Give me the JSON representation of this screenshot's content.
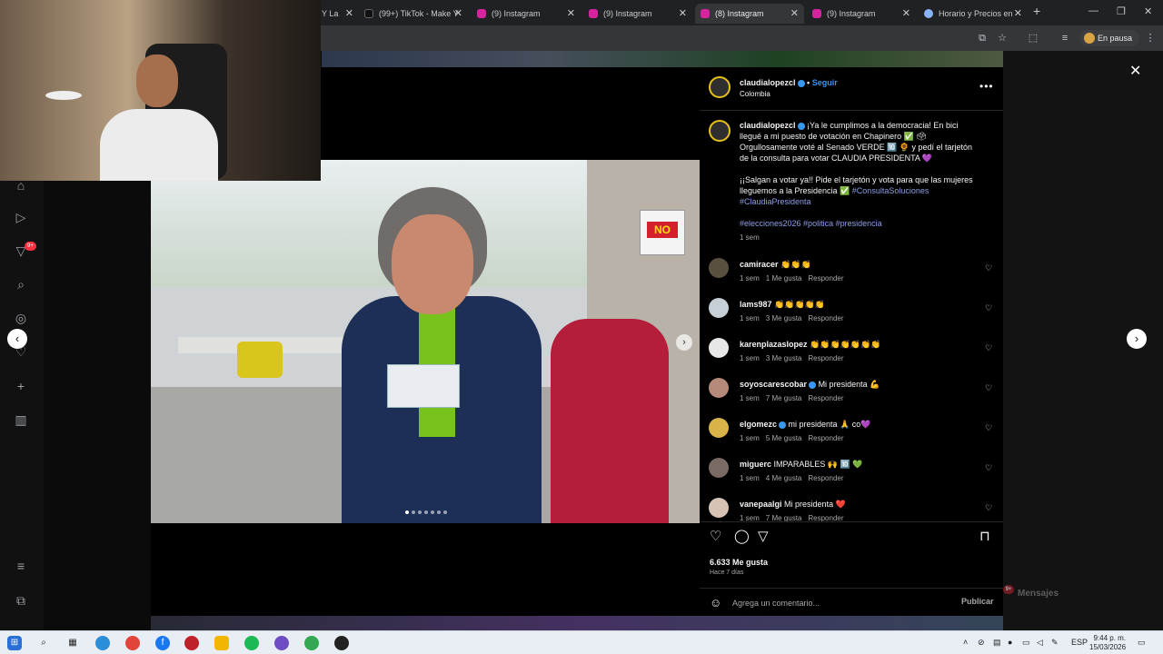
{
  "browser": {
    "tabs": [
      {
        "title": "Y La",
        "color": "#c0392b",
        "active": false
      },
      {
        "title": "(99+) TikTok - Make Y",
        "color": "#111111",
        "active": false
      },
      {
        "title": "(9) Instagram",
        "color": "#d6249f",
        "active": false
      },
      {
        "title": "(9) Instagram",
        "color": "#d6249f",
        "active": false
      },
      {
        "title": "(8) Instagram",
        "color": "#d6249f",
        "active": true
      },
      {
        "title": "(9) Instagram",
        "color": "#d6249f",
        "active": false
      },
      {
        "title": "Horario y Precios en",
        "color": "#8ab4f8",
        "active": false
      }
    ],
    "new_tab": "+",
    "profile_pill": "En pausa"
  },
  "post": {
    "author": "claudialopezcl",
    "follow": "Seguir",
    "location": "Colombia",
    "caption_line1": "¡Ya le cumplimos a la democracia! En bici llegué a mi puesto de votación en Chapinero ✅ 🗳 Orgullosamente voté al Senado VERDE 🔟 🌻 y pedí el tarjetón de la consulta para votar CLAUDIA PRESIDENTA 💜",
    "caption_line2": "¡¡Salgan a votar ya!! Pide el tarjetón y vota para que las mujeres lleguemos a la Presidencia ✅",
    "caption_tags2": "#ConsultaSoluciones #ClaudiaPresidenta",
    "caption_tags3": "#elecciones2026 #politica #presidencia",
    "caption_time": "1 sem",
    "photo_sign": "NO",
    "likes": "6.633 Me gusta",
    "ago": "Hace 7 días",
    "comment_placeholder": "Agrega un comentario...",
    "publish": "Publicar"
  },
  "comments": [
    {
      "user": "camiracer",
      "text": "👏👏👏",
      "time": "1 sem",
      "likes": "1 Me gusta",
      "reply": "Responder",
      "avatar": "#5a5040",
      "verified": false
    },
    {
      "user": "lams987",
      "text": "👏👏👏👏👏",
      "time": "1 sem",
      "likes": "3 Me gusta",
      "reply": "Responder",
      "avatar": "#c6cfd6",
      "verified": false
    },
    {
      "user": "karenplazaslopez",
      "text": "👏👏👏👏👏👏👏",
      "time": "1 sem",
      "likes": "3 Me gusta",
      "reply": "Responder",
      "avatar": "#e7e7e7",
      "verified": false
    },
    {
      "user": "soyoscarescobar",
      "text": "Mi presidenta 💪",
      "time": "1 sem",
      "likes": "7 Me gusta",
      "reply": "Responder",
      "avatar": "#b58a7a",
      "verified": true
    },
    {
      "user": "elgomezc",
      "text": "mi presidenta 🙏 co💜",
      "time": "1 sem",
      "likes": "5 Me gusta",
      "reply": "Responder",
      "avatar": "#d8b34a",
      "verified": true
    },
    {
      "user": "miguerc",
      "text": "IMPARABLES 🙌 🔟 💚",
      "time": "1 sem",
      "likes": "4 Me gusta",
      "reply": "Responder",
      "avatar": "#7a6a64",
      "verified": false
    },
    {
      "user": "vanepaalgi",
      "text": "Mi presidenta ❤️",
      "time": "1 sem",
      "likes": "7 Me gusta",
      "reply": "Responder",
      "avatar": "#d7c2b6",
      "verified": false
    }
  ],
  "messages": {
    "label": "Mensajes",
    "badge": "9+"
  },
  "rail_badge": "9+",
  "taskbar": {
    "lang": "ESP",
    "time": "9:44 p. m.",
    "date": "15/03/2026"
  },
  "icons": {
    "close": "close-icon",
    "next": "chevron-right-icon",
    "prev": "chevron-left-icon",
    "heart": "heart-icon",
    "comment": "comment-icon",
    "share": "share-icon",
    "save": "bookmark-icon"
  }
}
